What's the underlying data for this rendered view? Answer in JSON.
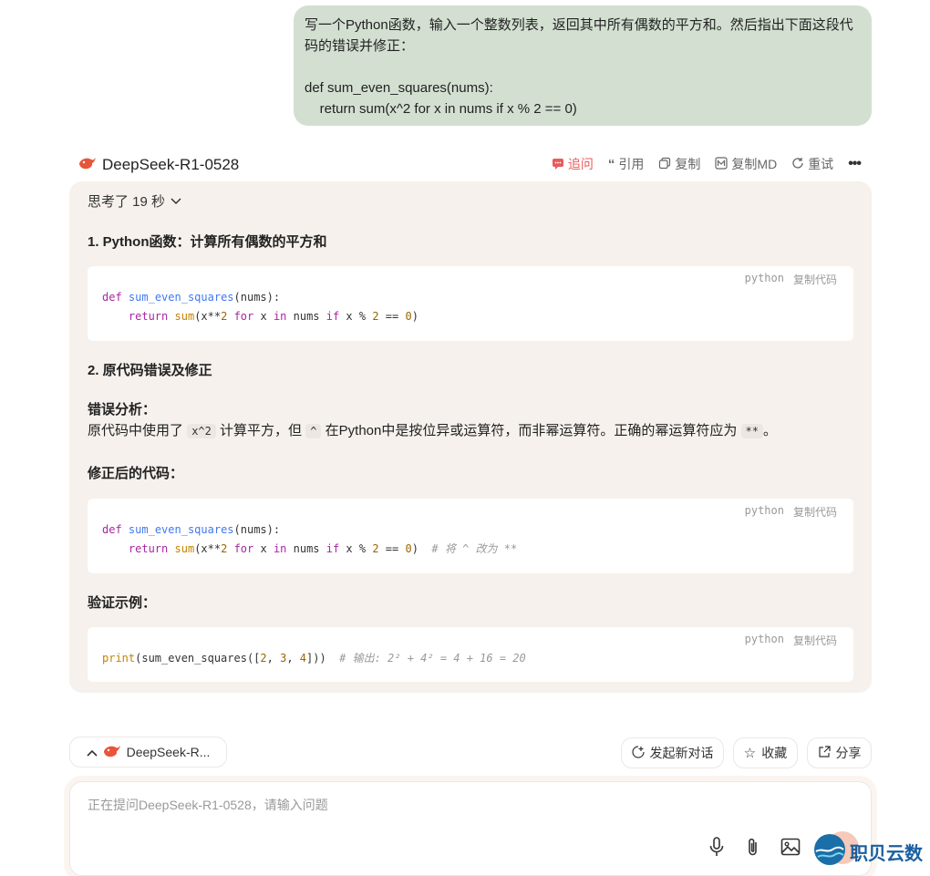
{
  "user_message": {
    "lines": [
      "写一个Python函数，输入一个整数列表，返回其中所有偶数的平方和。然后指出下面这段代",
      "码的错误并修正：",
      "",
      "def sum_even_squares(nums):",
      "    return sum(x^2 for x in nums if x % 2 == 0)"
    ]
  },
  "model": {
    "name": "DeepSeek-R1-0528"
  },
  "actions": {
    "followup": "追问",
    "quote": "引用",
    "copy": "复制",
    "copy_md": "复制MD",
    "retry": "重试"
  },
  "answer": {
    "thinking": "思考了 19 秒",
    "h1": "1. Python函数：计算所有偶数的平方和",
    "h2": "2. 原代码错误及修正",
    "error_label": "错误分析：",
    "error_text_1": "原代码中使用了",
    "error_code_1": "x^2",
    "error_text_2": "计算平方，但",
    "error_code_2": "^",
    "error_text_3": "在Python中是按位异或运算符，而非幂运算符。正确的幂运算符应为",
    "error_code_3": "**",
    "error_text_4": "。",
    "fixed_label": "修正后的代码：",
    "verify_label": "验证示例：",
    "code_lang": "python",
    "copy_code": "复制代码"
  },
  "bottom": {
    "model_pill": "DeepSeek-R...",
    "new_chat": "发起新对话",
    "favorite": "收藏",
    "share": "分享",
    "input_placeholder": "正在提问DeepSeek-R1-0528，请输入问题",
    "watermark": "职贝云数"
  },
  "colors": {
    "bubble": "#d3e0d1",
    "card": "#f6f1ec",
    "accent": "#e85b5b"
  }
}
